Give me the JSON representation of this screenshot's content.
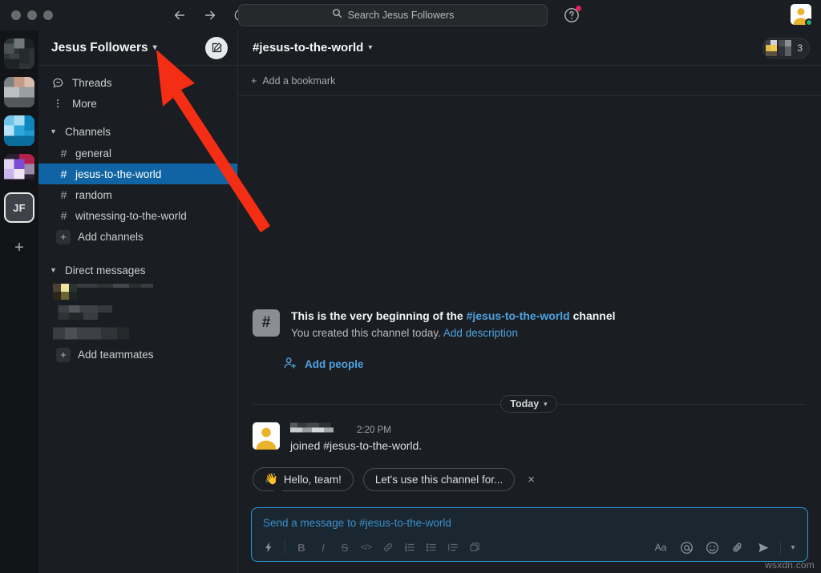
{
  "window": {
    "traffic_lights": [
      "close",
      "minimize",
      "zoom"
    ],
    "nav": {
      "back": "back-arrow",
      "forward": "forward-arrow",
      "history": "clock-icon"
    }
  },
  "search": {
    "placeholder": "Search Jesus Followers",
    "icon": "search-icon"
  },
  "help": {
    "icon": "help-icon",
    "has_notification": true
  },
  "user": {
    "avatar": "user-avatar",
    "presence": "online",
    "presence_color": "#2bac76"
  },
  "rail": {
    "workspaces": [
      {
        "name": "workspace-1",
        "blurred": true
      },
      {
        "name": "workspace-2",
        "blurred": true
      },
      {
        "name": "workspace-3",
        "blurred": true
      },
      {
        "name": "workspace-4",
        "blurred": true
      }
    ],
    "active_workspace": {
      "initials": "JF",
      "name": "Jesus Followers"
    },
    "add_label": "+"
  },
  "sidebar": {
    "workspace_name": "Jesus Followers",
    "workspace_chevron": "chevron-down-icon",
    "compose_button": "compose-icon",
    "nav": [
      {
        "label": "Threads",
        "icon": "threads-icon"
      },
      {
        "label": "More",
        "icon": "more-vertical-icon"
      }
    ],
    "channels_section": {
      "label": "Channels",
      "expanded": true,
      "items": [
        {
          "name": "general",
          "active": false
        },
        {
          "name": "jesus-to-the-world",
          "active": true
        },
        {
          "name": "random",
          "active": false
        },
        {
          "name": "witnessing-to-the-world",
          "active": false
        }
      ],
      "add_label": "Add channels"
    },
    "dm_section": {
      "label": "Direct messages",
      "expanded": true,
      "items": [
        {
          "name": "dm-1",
          "blurred": true
        },
        {
          "name": "dm-2",
          "blurred": true
        },
        {
          "name": "dm-3",
          "blurred": true
        }
      ],
      "add_label": "Add teammates"
    }
  },
  "channel": {
    "title": "#jesus-to-the-world",
    "title_chevron": "chevron-down-icon",
    "member_count": "3",
    "bookmark_label": "Add a bookmark",
    "bookmark_icon": "plus-icon"
  },
  "intro": {
    "line1_prefix": "This is the very beginning of the ",
    "line1_link": "#jesus-to-the-world",
    "line1_suffix": " channel",
    "line2_prefix": "You created this channel today. ",
    "line2_link": "Add description",
    "add_people_label": "Add people",
    "add_people_icon": "add-person-icon",
    "channel_icon": "hash-icon"
  },
  "divider": {
    "label": "Today",
    "chevron": "chevron-down-icon"
  },
  "join_message": {
    "author": "blurred-username",
    "author_blurred": true,
    "timestamp": "2:20 PM",
    "text": "joined #jesus-to-the-world.",
    "avatar": "user-avatar"
  },
  "suggestion_chips": [
    {
      "emoji": "👋",
      "label": "Hello, team!",
      "has_tail": true
    },
    {
      "emoji": "",
      "label": "Let's use this channel for...",
      "has_tail": false
    }
  ],
  "chips_close": "×",
  "composer": {
    "placeholder": "Send a message to #jesus-to-the-world",
    "accent_color": "#2d9ad6",
    "left_tools": [
      {
        "icon": "lightning-icon",
        "label": ""
      },
      {
        "icon": "bold-icon",
        "label": "B"
      },
      {
        "icon": "italic-icon",
        "label": "I"
      },
      {
        "icon": "strikethrough-icon",
        "label": "S"
      },
      {
        "icon": "code-icon",
        "label": "</>"
      },
      {
        "icon": "link-icon",
        "label": ""
      },
      {
        "icon": "ordered-list-icon",
        "label": ""
      },
      {
        "icon": "bulleted-list-icon",
        "label": ""
      },
      {
        "icon": "blockquote-icon",
        "label": ""
      },
      {
        "icon": "code-block-icon",
        "label": ""
      }
    ],
    "right_tools": [
      {
        "icon": "formatting-icon",
        "label": "Aa"
      },
      {
        "icon": "mention-icon",
        "label": "@"
      },
      {
        "icon": "emoji-icon",
        "label": ""
      },
      {
        "icon": "attachment-icon",
        "label": ""
      },
      {
        "icon": "send-icon",
        "label": ""
      },
      {
        "icon": "send-options-chevron-icon",
        "label": ""
      }
    ]
  },
  "annotation": {
    "arrow": "red-arrow-pointing-to-workspace-name",
    "color": "#f42d15"
  },
  "watermark": "wsxdn.com",
  "colors": {
    "app_bg": "#1a1d21",
    "rail_bg": "#131417",
    "active_channel": "#1164a3",
    "link": "#4ea3e0",
    "text_primary": "#f3f4f5",
    "text_secondary": "#cdced1"
  }
}
